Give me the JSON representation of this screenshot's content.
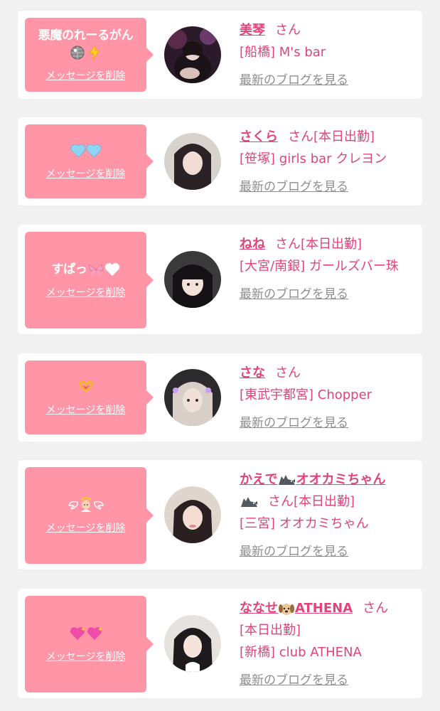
{
  "labels": {
    "delete": "メッセージを削除",
    "san": "さん",
    "today": "[本日出勤]",
    "blog": "最新のブログを見る"
  },
  "cards": [
    {
      "message": "悪魔のれーるがん",
      "message_emoji": [
        "disco-ball-icon",
        "lightning-icon"
      ],
      "name": "美琴",
      "today": false,
      "shop": "[船橋] M's bar"
    },
    {
      "message": "",
      "message_emoji": [
        "light-blue-heart-icon",
        "light-blue-heart-icon"
      ],
      "name": "さくら",
      "today": true,
      "shop": "[笹塚] girls bar クレヨン"
    },
    {
      "message": "すぱっ",
      "message_emoji": [
        "ribbon-icon",
        "white-heart-icon"
      ],
      "name": "ねね",
      "today": true,
      "shop": "[大宮/南銀] ガールズバー珠"
    },
    {
      "message": "",
      "message_emoji": [
        "heart-hands-icon"
      ],
      "name": "さな",
      "today": false,
      "shop": "[東武宇都宮] Chopper"
    },
    {
      "message": "",
      "message_emoji": [
        "wing-icon",
        "baby-angel-icon",
        "wing-icon"
      ],
      "name": "かえで",
      "name_suffix": "オオカミちゃん",
      "name_emoji": [
        "wolf-icon",
        "wolf-icon"
      ],
      "today": true,
      "shop": "[三宮] オオカミちゃん"
    },
    {
      "message": "",
      "message_emoji": [
        "sparkling-heart-icon",
        "sparkling-heart-icon"
      ],
      "name": "ななせ",
      "name_suffix": "ATHENA",
      "name_emoji": [
        "dog-icon"
      ],
      "today": true,
      "shop": "[新橋] club ATHENA"
    }
  ]
}
